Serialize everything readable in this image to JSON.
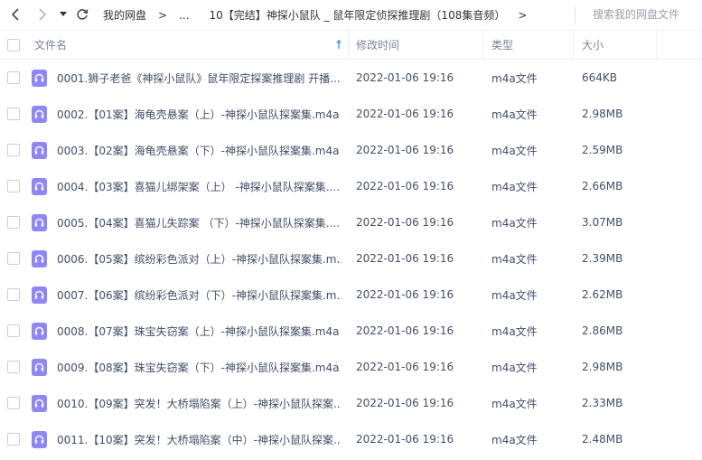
{
  "nav": {
    "breadcrumb": [
      {
        "label": "我的网盘"
      },
      {
        "label": "..."
      },
      {
        "label": "10【完结】神探小鼠队 _ 鼠年限定侦探推理剧（108集音频）"
      }
    ],
    "separator": ">",
    "search_placeholder": "搜索我的网盘文件"
  },
  "table": {
    "columns": {
      "name": "文件名",
      "modified": "修改时间",
      "type": "类型",
      "size": "大小"
    },
    "rows": [
      {
        "name": "0001.狮子老爸《神探小鼠队》鼠年限定探案推理剧 开播...",
        "modified": "2022-01-06 19:16",
        "type": "m4a文件",
        "size": "664KB"
      },
      {
        "name": "0002.【01案】海龟壳悬案（上）-神探小鼠队探案集.m4a",
        "modified": "2022-01-06 19:16",
        "type": "m4a文件",
        "size": "2.98MB"
      },
      {
        "name": "0003.【02案】海龟壳悬案（下）-神探小鼠队探案集.m4a",
        "modified": "2022-01-06 19:16",
        "type": "m4a文件",
        "size": "2.59MB"
      },
      {
        "name": "0004.【03案】喜猫儿绑架案（上） -神探小鼠队探案集....",
        "modified": "2022-01-06 19:16",
        "type": "m4a文件",
        "size": "2.66MB"
      },
      {
        "name": "0005.【04案】喜猫儿失踪案 （下）-神探小鼠队探案集....",
        "modified": "2022-01-06 19:16",
        "type": "m4a文件",
        "size": "3.07MB"
      },
      {
        "name": "0006.【05案】缤纷彩色派对（上）-神探小鼠队探案集.m...",
        "modified": "2022-01-06 19:16",
        "type": "m4a文件",
        "size": "2.39MB"
      },
      {
        "name": "0007.【06案】缤纷彩色派对（下）-神探小鼠队探案集.m...",
        "modified": "2022-01-06 19:16",
        "type": "m4a文件",
        "size": "2.62MB"
      },
      {
        "name": "0008.【07案】珠宝失窃案（上）-神探小鼠队探案集.m4a",
        "modified": "2022-01-06 19:16",
        "type": "m4a文件",
        "size": "2.86MB"
      },
      {
        "name": "0009.【08案】珠宝失窃案（下）-神探小鼠队探案集.m4a",
        "modified": "2022-01-06 19:16",
        "type": "m4a文件",
        "size": "2.98MB"
      },
      {
        "name": "0010.【09案】突发！大桥塌陷案（上）-神探小鼠队探案...",
        "modified": "2022-01-06 19:16",
        "type": "m4a文件",
        "size": "2.33MB"
      },
      {
        "name": "0011.【10案】突发！大桥塌陷案（中）-神探小鼠队探案...",
        "modified": "2022-01-06 19:16",
        "type": "m4a文件",
        "size": "2.48MB"
      }
    ]
  },
  "colors": {
    "file_icon": "#8f86f7",
    "sort_arrow": "#4a9bf5",
    "text": "#424e67",
    "header_text": "#7b8497"
  }
}
